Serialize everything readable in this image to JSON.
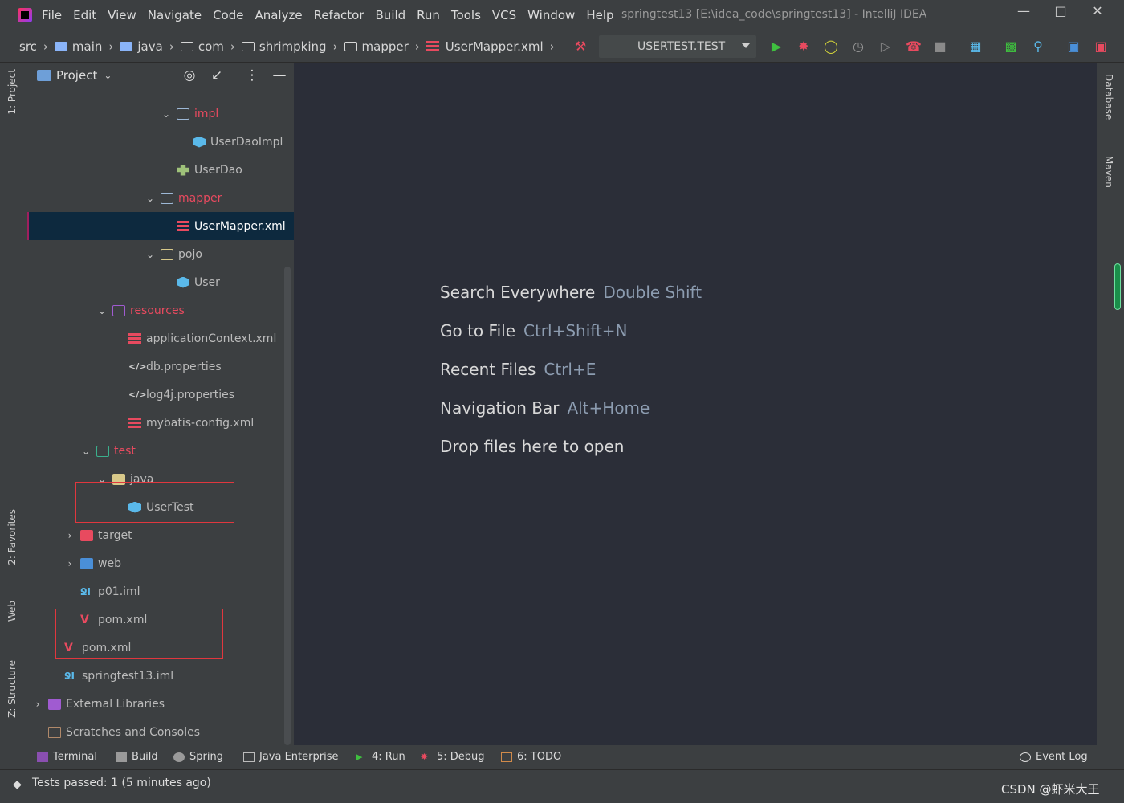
{
  "menu": {
    "items": [
      "File",
      "Edit",
      "View",
      "Navigate",
      "Code",
      "Analyze",
      "Refactor",
      "Build",
      "Run",
      "Tools",
      "VCS",
      "Window",
      "Help"
    ],
    "window_title": "springtest13 [E:\\idea_code\\springtest13] - IntelliJ IDEA"
  },
  "breadcrumbs": [
    "src",
    "main",
    "java",
    "com",
    "shrimpking",
    "mapper",
    "UserMapper.xml"
  ],
  "run_config": "USERTEST.TEST",
  "project_panel": {
    "title": "Project",
    "tree": [
      {
        "label": "impl",
        "kind": "folder",
        "color": "pink",
        "expanded": true
      },
      {
        "label": "UserDaoImpl",
        "kind": "class"
      },
      {
        "label": "UserDao",
        "kind": "interface"
      },
      {
        "label": "mapper",
        "kind": "folder",
        "color": "pink",
        "expanded": true
      },
      {
        "label": "UserMapper.xml",
        "kind": "xml",
        "selected": true
      },
      {
        "label": "pojo",
        "kind": "folder",
        "expanded": true
      },
      {
        "label": "User",
        "kind": "class"
      },
      {
        "label": "resources",
        "kind": "folder-res",
        "color": "pink",
        "expanded": true
      },
      {
        "label": "applicationContext.xml",
        "kind": "xml"
      },
      {
        "label": "db.properties",
        "kind": "props"
      },
      {
        "label": "log4j.properties",
        "kind": "props"
      },
      {
        "label": "mybatis-config.xml",
        "kind": "xml"
      },
      {
        "label": "test",
        "kind": "folder-teal",
        "color": "pink",
        "expanded": true
      },
      {
        "label": "java",
        "kind": "folder-yellow",
        "expanded": true
      },
      {
        "label": "UserTest",
        "kind": "class"
      },
      {
        "label": "target",
        "kind": "folder-red",
        "expanded": false
      },
      {
        "label": "web",
        "kind": "folder-blue",
        "expanded": false
      },
      {
        "label": "p01.iml",
        "kind": "iml"
      },
      {
        "label": "pom.xml",
        "kind": "maven"
      },
      {
        "label": "pom.xml",
        "kind": "maven"
      },
      {
        "label": "springtest13.iml",
        "kind": "iml"
      },
      {
        "label": "External Libraries",
        "kind": "lib",
        "expanded": false
      },
      {
        "label": "Scratches and Consoles",
        "kind": "scratch"
      }
    ]
  },
  "left_tabs": [
    "1: Project",
    "2: Favorites",
    "Web",
    "Z: Structure"
  ],
  "right_tabs": [
    "Database",
    "Maven"
  ],
  "welcome_hints": [
    {
      "action": "Search Everywhere",
      "key": "Double Shift"
    },
    {
      "action": "Go to File",
      "key": "Ctrl+Shift+N"
    },
    {
      "action": "Recent Files",
      "key": "Ctrl+E"
    },
    {
      "action": "Navigation Bar",
      "key": "Alt+Home"
    },
    {
      "action": "Drop files here to open",
      "key": ""
    }
  ],
  "bottom_tools": [
    "Terminal",
    "Build",
    "Spring",
    "Java Enterprise",
    "4: Run",
    "5: Debug",
    "6: TODO",
    "Event Log"
  ],
  "status": "Tests passed: 1 (5 minutes ago)",
  "watermark": "CSDN @虾米大王",
  "colors": {
    "accent_pink": "#e84a5f",
    "selection": "#0d293e",
    "background": "#2b2e38",
    "panel": "#3c3f41"
  }
}
